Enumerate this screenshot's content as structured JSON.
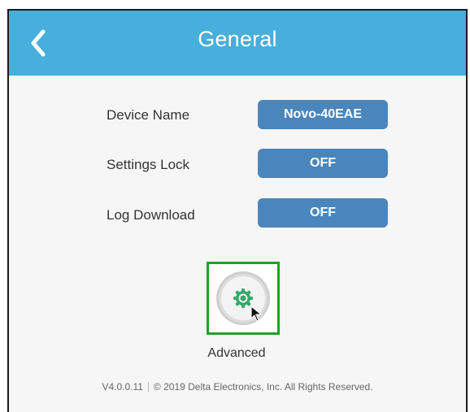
{
  "header": {
    "title": "General",
    "back_icon": "chevron-left-icon"
  },
  "settings": [
    {
      "label": "Device Name",
      "value": "Novo-40EAE"
    },
    {
      "label": "Settings Lock",
      "value": "OFF"
    },
    {
      "label": "Log Download",
      "value": "OFF"
    }
  ],
  "advanced": {
    "label": "Advanced",
    "icon": "gear-icon"
  },
  "footer": {
    "version": "V4.0.0.11",
    "copyright": "© 2019 Delta Electronics, Inc. All Rights Reserved."
  },
  "colors": {
    "header_bg": "#48aedb",
    "button_bg": "#4a86bb",
    "gear": "#37a86a",
    "highlight": "#23a02a"
  }
}
